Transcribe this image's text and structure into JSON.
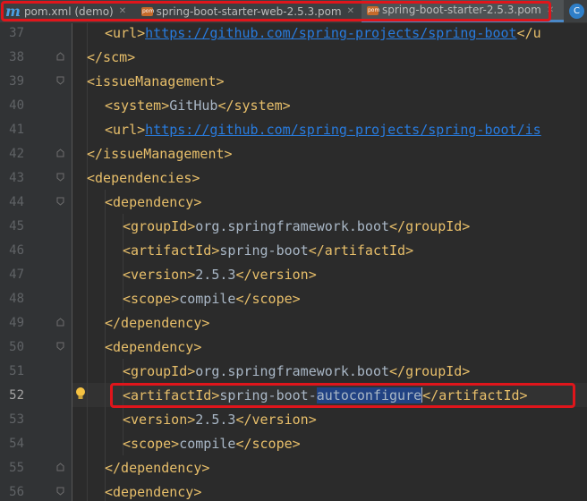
{
  "tabs": [
    {
      "label": "pom.xml (demo)",
      "icon": "maven-m-icon"
    },
    {
      "label": "spring-boot-starter-web-2.5.3.pom",
      "icon": "pom-file-icon"
    },
    {
      "label": "spring-boot-starter-2.5.3.pom",
      "icon": "pom-file-icon",
      "active": true
    },
    {
      "label": "C",
      "icon": "class-icon"
    }
  ],
  "editor": {
    "current_line": "52",
    "line_numbers": [
      "37",
      "38",
      "39",
      "40",
      "41",
      "42",
      "43",
      "44",
      "45",
      "46",
      "47",
      "48",
      "49",
      "50",
      "51",
      "52",
      "53",
      "54",
      "55",
      "56"
    ],
    "lines": {
      "l37": {
        "open": "<url>",
        "url": "https://github.com/spring-projects/spring-boot",
        "close": "</u"
      },
      "l38": {
        "open": "</scm>"
      },
      "l39": {
        "open": "<issueManagement>"
      },
      "l40": {
        "open": "<system>",
        "text": "GitHub",
        "close": "</system>"
      },
      "l41": {
        "open": "<url>",
        "url": "https://github.com/spring-projects/spring-boot/is"
      },
      "l42": {
        "open": "</issueManagement>"
      },
      "l43": {
        "open": "<dependencies>"
      },
      "l44": {
        "open": "<dependency>"
      },
      "l45": {
        "open": "<groupId>",
        "text": "org.springframework.boot",
        "close": "</groupId>"
      },
      "l46": {
        "open": "<artifactId>",
        "text": "spring-boot",
        "close": "</artifactId>"
      },
      "l47": {
        "open": "<version>",
        "text": "2.5.3",
        "close": "</version>"
      },
      "l48": {
        "open": "<scope>",
        "text": "compile",
        "close": "</scope>"
      },
      "l49": {
        "open": "</dependency>"
      },
      "l50": {
        "open": "<dependency>"
      },
      "l51": {
        "open": "<groupId>",
        "text": "org.springframework.boot",
        "close": "</groupId>"
      },
      "l52": {
        "open": "<artifactId>",
        "text": "spring-boot-",
        "highlight": "autoconfigure",
        "close": "</artifactId>"
      },
      "l53": {
        "open": "<version>",
        "text": "2.5.3",
        "close": "</version>"
      },
      "l54": {
        "open": "<scope>",
        "text": "compile",
        "close": "</scope>"
      },
      "l55": {
        "open": "</dependency>"
      },
      "l56": {
        "open": "<dependency>"
      }
    }
  },
  "colors": {
    "tag": "#e8bf6a",
    "text": "#a9b7c6",
    "url": "#287bde",
    "selection": "#214283",
    "annotation_box": "#e0151b",
    "background": "#2b2b2b"
  }
}
